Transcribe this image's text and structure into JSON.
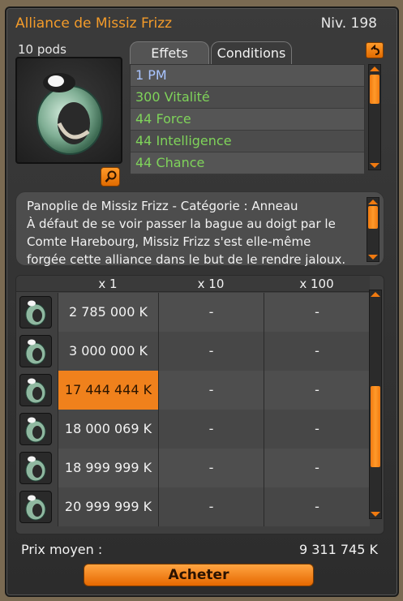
{
  "window": {
    "title": "Alliance de Missiz Frizz",
    "level": "Niv. 198"
  },
  "item": {
    "pods": "10 pods",
    "icon": "ring-icon"
  },
  "tabs": [
    {
      "label": "Effets",
      "active": true
    },
    {
      "label": "Conditions",
      "active": false
    }
  ],
  "effects": [
    {
      "text": "1 PM",
      "color": "#a9c4ff"
    },
    {
      "text": "300 Vitalité",
      "color": "#7fd35a"
    },
    {
      "text": "44 Force",
      "color": "#7fd35a"
    },
    {
      "text": "44 Intelligence",
      "color": "#7fd35a"
    },
    {
      "text": "44 Chance",
      "color": "#7fd35a"
    }
  ],
  "description": {
    "line1": "Panoplie de Missiz Frizz - Catégorie : Anneau",
    "line2": "À défaut de se voir passer la bague au doigt par le",
    "line3": "Comte Harebourg, Missiz Frizz s'est elle-même",
    "line4": "forgée cette alliance dans le but de le rendre jaloux."
  },
  "table": {
    "headers": [
      "x 1",
      "x 10",
      "x 100"
    ],
    "rows": [
      {
        "x1": "2 785 000 K",
        "x10": "-",
        "x100": "-"
      },
      {
        "x1": "3 000 000 K",
        "x10": "-",
        "x100": "-"
      },
      {
        "x1": "17 444 444 K",
        "x10": "-",
        "x100": "-",
        "selected": true
      },
      {
        "x1": "18 000 069 K",
        "x10": "-",
        "x100": "-"
      },
      {
        "x1": "18 999 999 K",
        "x10": "-",
        "x100": "-"
      },
      {
        "x1": "20 999 999 K",
        "x10": "-",
        "x100": "-"
      }
    ]
  },
  "average": {
    "label": "Prix moyen :",
    "value": "9 311 745 K"
  },
  "buy_button": "Acheter",
  "colors": {
    "accent": "#f39b2a",
    "highlight": "#f0811c"
  }
}
